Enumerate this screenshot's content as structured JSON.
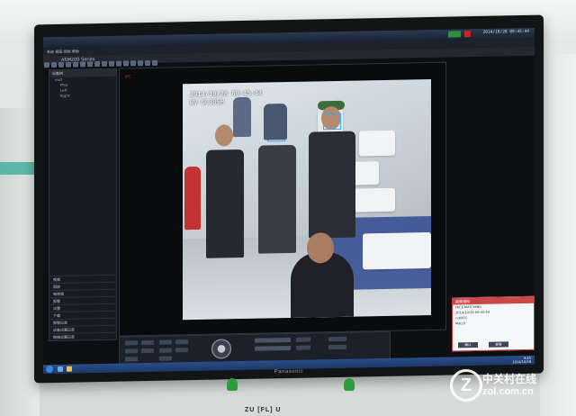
{
  "scene": {
    "tv_brand": "Panasonic",
    "wall_text": "ZU [FL] U"
  },
  "screen": {
    "window_title": "ASM200 Series",
    "clock": "2014/10/28 09:45:44",
    "menu": "系统  视图  控制  帮助",
    "sidebar": {
      "header": "设备树",
      "tree": [
        "root",
        "Pfsa",
        "Left",
        "Right"
      ],
      "menu_items": [
        "视频",
        "回放",
        "电视墙",
        "报警",
        "设置",
        "下载",
        "报警日志",
        "设备设置日志",
        "网络设置日志"
      ]
    },
    "camera_label": "IPC",
    "osd": {
      "datetime": "2014/10/28 09:45:44",
      "camera": "WV-SC385H"
    },
    "alarm": {
      "title": "报警通知",
      "lines": [
        "FACE MATCHING",
        "2014/10/28 09:45:44",
        "cs0001",
        "Match"
      ],
      "buttons": [
        "确认",
        "查看"
      ]
    },
    "taskbar": {
      "time": "9:45",
      "date": "2014/10/28"
    }
  },
  "watermark": {
    "logo": "Z",
    "site_cn": "中关村在线",
    "site_url": "zol.com.cn"
  }
}
